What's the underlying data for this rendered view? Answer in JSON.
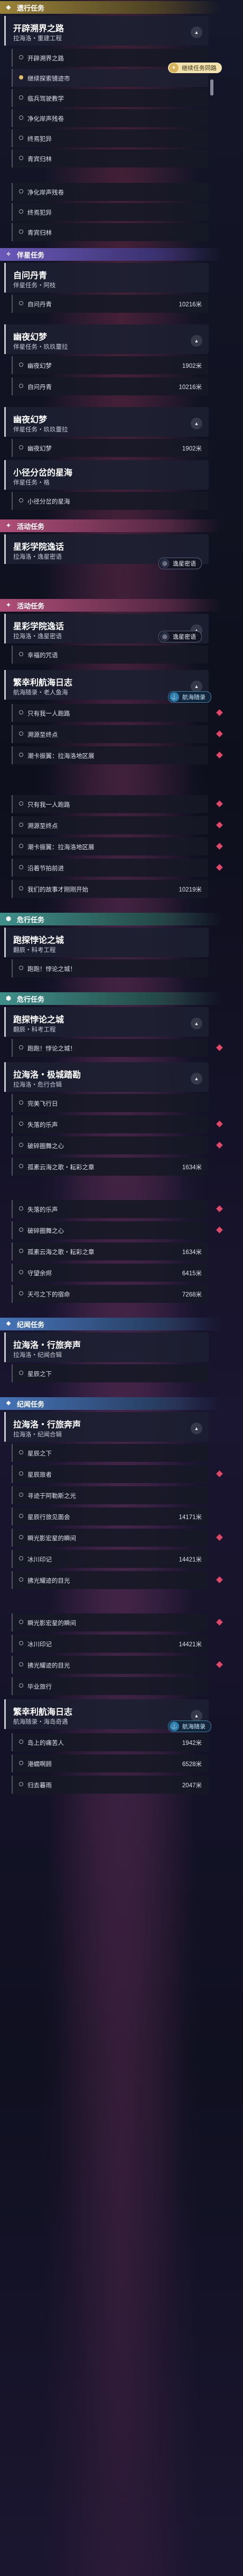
{
  "sections": [
    {
      "label": "遗行任务",
      "color": "yellow"
    },
    {
      "label": "伴星任务",
      "color": "purple"
    },
    {
      "label": "活动任务",
      "color": "pink"
    },
    {
      "label": "活动任务",
      "color": "pink"
    },
    {
      "label": "危行任务",
      "color": "teal"
    },
    {
      "label": "危行任务",
      "color": "teal"
    },
    {
      "label": "纪闻任务",
      "color": "blue"
    },
    {
      "label": "纪闻任务",
      "color": "blue"
    }
  ],
  "cards": [
    {
      "title": "开辟溯界之路",
      "sub": "拉海洛・重建工程"
    },
    {
      "title": "自问丹青",
      "sub": "伴星任务・阿枝"
    },
    {
      "title": "幽夜幻梦",
      "sub": "伴星任务・玖玖蕾拉"
    },
    {
      "title": "幽夜幻梦",
      "sub": "伴星任务・玖玖蕾拉"
    },
    {
      "title": "小径分岔的星海",
      "sub": "伴星任务・格"
    },
    {
      "title": "星彩学院逸话",
      "sub": "拉海洛・逸星密语"
    },
    {
      "title": "星彩学院逸话",
      "sub": "拉海洛・逸星密语"
    },
    {
      "title": "繁幸利航海日志",
      "sub": "航海随录・老人鱼海"
    },
    {
      "title": "跑探悖论之城",
      "sub": "翻辰・科考工程"
    },
    {
      "title": "跑探悖论之城",
      "sub": "翻辰・科考工程"
    },
    {
      "title": "拉海洛・极城踏勘",
      "sub": "拉海洛・危行合辑"
    },
    {
      "title": "拉海洛・行旅奔声",
      "sub": "拉海洛・纪闻合辑"
    },
    {
      "title": "拉海洛・行旅奔声",
      "sub": "拉海洛・纪闻合辑"
    },
    {
      "title": "繁幸利航海日志",
      "sub": "航海随录・海岛奇遇"
    }
  ],
  "rows": [
    {
      "text": "开辟溯界之路"
    },
    {
      "text": "继续探索镜迹市"
    },
    {
      "text": "临兵驾驶教学"
    },
    {
      "text": "净化岸声残卷"
    },
    {
      "text": "终焉犯异"
    },
    {
      "text": "青宾归林"
    },
    {
      "text": "净化岸声残卷"
    },
    {
      "text": "终焉犯异"
    },
    {
      "text": "青宾归林"
    },
    {
      "text": "自问丹青",
      "dist": "10216米"
    },
    {
      "text": "幽夜幻梦",
      "dist": "1902米"
    },
    {
      "text": "自问丹青",
      "dist": "10216米"
    },
    {
      "text": "幽夜幻梦",
      "dist": "1902米"
    },
    {
      "text": "小径分岔的星海"
    },
    {
      "text": "幸福的咒语"
    },
    {
      "text": "只有我一人跑路"
    },
    {
      "text": "溯源至终点"
    },
    {
      "text": "潮卡振翼：拉海洛地区展"
    },
    {
      "text": "只有我一人跑路"
    },
    {
      "text": "溯源至终点"
    },
    {
      "text": "潮卡振翼：拉海洛地区展"
    },
    {
      "text": "沿着节拍前进"
    },
    {
      "text": "我们的故事才刚刚开始",
      "dist": "10219米"
    },
    {
      "text": "跑跑！悖论之城！"
    },
    {
      "text": "跑跑！悖论之城！"
    },
    {
      "text": "完美飞行日"
    },
    {
      "text": "失落的乐声"
    },
    {
      "text": "破碎圈舞之心"
    },
    {
      "text": "孤素云海之歌・耘彩之章",
      "dist": "1634米"
    },
    {
      "text": "失落的乐声"
    },
    {
      "text": "破碎圈舞之心"
    },
    {
      "text": "孤素云海之歌・耘彩之章",
      "dist": "1634米"
    },
    {
      "text": "守望余烬",
      "dist": "6415米"
    },
    {
      "text": "天弓之下的宿命",
      "dist": "7268米"
    },
    {
      "text": "星辰之下"
    },
    {
      "text": "星辰之下"
    },
    {
      "text": "星辰旅者"
    },
    {
      "text": "寻迹于阿勒斯之光"
    },
    {
      "text": "星辰行旅见面会",
      "dist": "14171米"
    },
    {
      "text": "瞬光影宏星的瞬间"
    },
    {
      "text": "冰川印记",
      "dist": "14421米"
    },
    {
      "text": "拂光耀迹的目光"
    },
    {
      "text": "瞬光影宏星的瞬间"
    },
    {
      "text": "冰川印记",
      "dist": "14421米"
    },
    {
      "text": "拂光耀迹的目光"
    },
    {
      "text": "毕业旅行"
    },
    {
      "text": "岛上的痛苦人",
      "dist": "1942米"
    },
    {
      "text": "港蠕啊顾",
      "dist": "6528米"
    },
    {
      "text": "归去暮雨",
      "dist": "2047米"
    }
  ],
  "tags": [
    {
      "text": "继续任务同路",
      "style": "yellow",
      "icon": "✦"
    },
    {
      "text": "逸星密语",
      "style": "dark",
      "icon": "◎"
    },
    {
      "text": "逸星密语",
      "style": "dark",
      "icon": "◎"
    },
    {
      "text": "航海随录",
      "style": "blue",
      "icon": "⚓"
    },
    {
      "text": "航海随录",
      "style": "blue",
      "icon": "⚓"
    }
  ]
}
